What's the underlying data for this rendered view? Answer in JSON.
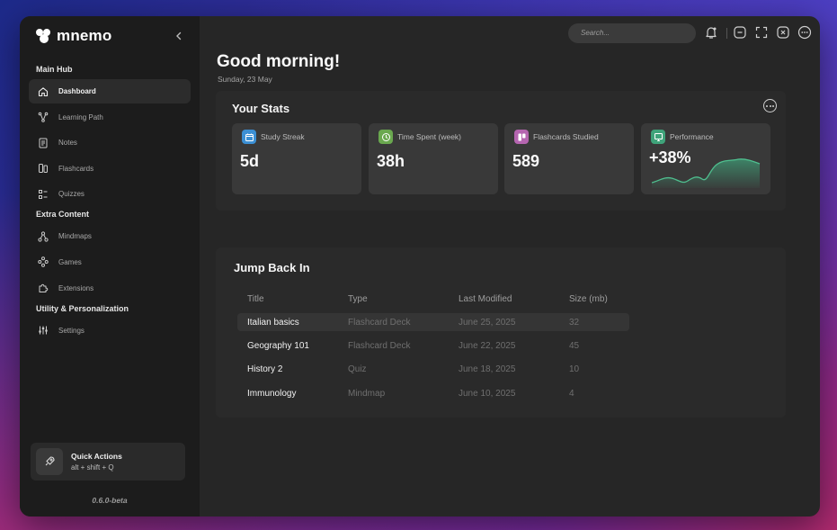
{
  "app": {
    "name": "mnemo",
    "version": "0.6.0-beta"
  },
  "sidebar": {
    "sections": [
      {
        "title": "Main Hub",
        "items": [
          {
            "label": "Dashboard",
            "icon": "home-icon",
            "active": true
          },
          {
            "label": "Learning Path",
            "icon": "path-icon",
            "active": false
          },
          {
            "label": "Notes",
            "icon": "notes-icon",
            "active": false
          },
          {
            "label": "Flashcards",
            "icon": "flashcards-icon",
            "active": false
          },
          {
            "label": "Quizzes",
            "icon": "quizzes-icon",
            "active": false
          }
        ]
      },
      {
        "title": "Extra Content",
        "items": [
          {
            "label": "Mindmaps",
            "icon": "mindmap-icon",
            "active": false
          },
          {
            "label": "Games",
            "icon": "games-icon",
            "active": false
          },
          {
            "label": "Extensions",
            "icon": "puzzle-icon",
            "active": false
          }
        ]
      },
      {
        "title": "Utility & Personalization",
        "items": [
          {
            "label": "Settings",
            "icon": "sliders-icon",
            "active": false
          }
        ]
      }
    ],
    "quick_actions": {
      "title": "Quick Actions",
      "shortcut": "alt + shift + Q"
    }
  },
  "topbar": {
    "search_placeholder": "Search..."
  },
  "header": {
    "greeting": "Good morning!",
    "date": "Sunday, 23 May"
  },
  "stats": {
    "title": "Your Stats",
    "cards": [
      {
        "label": "Study Streak",
        "value": "5d",
        "color": "#3b8fd4",
        "icon": "calendar-icon"
      },
      {
        "label": "Time Spent (week)",
        "value": "38h",
        "color": "#6aa84f",
        "icon": "clock-icon"
      },
      {
        "label": "Flashcards Studied",
        "value": "589",
        "color": "#b565b0",
        "icon": "cards-icon"
      },
      {
        "label": "Performance",
        "value": "+38%",
        "color": "#3fa37a",
        "icon": "monitor-icon"
      }
    ]
  },
  "jump_back": {
    "title": "Jump Back In",
    "columns": [
      "Title",
      "Type",
      "Last Modified",
      "Size (mb)"
    ],
    "rows": [
      [
        "Italian basics",
        "Flashcard Deck",
        "June 25, 2025",
        "32"
      ],
      [
        "Geography 101",
        "Flashcard Deck",
        "June 22, 2025",
        "45"
      ],
      [
        "History 2",
        "Quiz",
        "June 18, 2025",
        "10"
      ],
      [
        "Immunology",
        "Mindmap",
        "June 10, 2025",
        "4"
      ]
    ]
  }
}
